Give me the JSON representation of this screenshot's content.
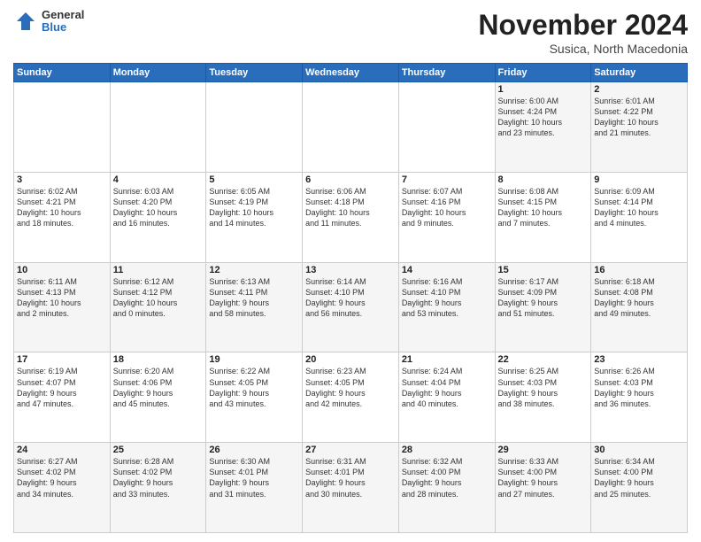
{
  "logo": {
    "general": "General",
    "blue": "Blue"
  },
  "header": {
    "month": "November 2024",
    "location": "Susica, North Macedonia"
  },
  "weekdays": [
    "Sunday",
    "Monday",
    "Tuesday",
    "Wednesday",
    "Thursday",
    "Friday",
    "Saturday"
  ],
  "weeks": [
    [
      {
        "day": "",
        "info": ""
      },
      {
        "day": "",
        "info": ""
      },
      {
        "day": "",
        "info": ""
      },
      {
        "day": "",
        "info": ""
      },
      {
        "day": "",
        "info": ""
      },
      {
        "day": "1",
        "info": "Sunrise: 6:00 AM\nSunset: 4:24 PM\nDaylight: 10 hours\nand 23 minutes."
      },
      {
        "day": "2",
        "info": "Sunrise: 6:01 AM\nSunset: 4:22 PM\nDaylight: 10 hours\nand 21 minutes."
      }
    ],
    [
      {
        "day": "3",
        "info": "Sunrise: 6:02 AM\nSunset: 4:21 PM\nDaylight: 10 hours\nand 18 minutes."
      },
      {
        "day": "4",
        "info": "Sunrise: 6:03 AM\nSunset: 4:20 PM\nDaylight: 10 hours\nand 16 minutes."
      },
      {
        "day": "5",
        "info": "Sunrise: 6:05 AM\nSunset: 4:19 PM\nDaylight: 10 hours\nand 14 minutes."
      },
      {
        "day": "6",
        "info": "Sunrise: 6:06 AM\nSunset: 4:18 PM\nDaylight: 10 hours\nand 11 minutes."
      },
      {
        "day": "7",
        "info": "Sunrise: 6:07 AM\nSunset: 4:16 PM\nDaylight: 10 hours\nand 9 minutes."
      },
      {
        "day": "8",
        "info": "Sunrise: 6:08 AM\nSunset: 4:15 PM\nDaylight: 10 hours\nand 7 minutes."
      },
      {
        "day": "9",
        "info": "Sunrise: 6:09 AM\nSunset: 4:14 PM\nDaylight: 10 hours\nand 4 minutes."
      }
    ],
    [
      {
        "day": "10",
        "info": "Sunrise: 6:11 AM\nSunset: 4:13 PM\nDaylight: 10 hours\nand 2 minutes."
      },
      {
        "day": "11",
        "info": "Sunrise: 6:12 AM\nSunset: 4:12 PM\nDaylight: 10 hours\nand 0 minutes."
      },
      {
        "day": "12",
        "info": "Sunrise: 6:13 AM\nSunset: 4:11 PM\nDaylight: 9 hours\nand 58 minutes."
      },
      {
        "day": "13",
        "info": "Sunrise: 6:14 AM\nSunset: 4:10 PM\nDaylight: 9 hours\nand 56 minutes."
      },
      {
        "day": "14",
        "info": "Sunrise: 6:16 AM\nSunset: 4:10 PM\nDaylight: 9 hours\nand 53 minutes."
      },
      {
        "day": "15",
        "info": "Sunrise: 6:17 AM\nSunset: 4:09 PM\nDaylight: 9 hours\nand 51 minutes."
      },
      {
        "day": "16",
        "info": "Sunrise: 6:18 AM\nSunset: 4:08 PM\nDaylight: 9 hours\nand 49 minutes."
      }
    ],
    [
      {
        "day": "17",
        "info": "Sunrise: 6:19 AM\nSunset: 4:07 PM\nDaylight: 9 hours\nand 47 minutes."
      },
      {
        "day": "18",
        "info": "Sunrise: 6:20 AM\nSunset: 4:06 PM\nDaylight: 9 hours\nand 45 minutes."
      },
      {
        "day": "19",
        "info": "Sunrise: 6:22 AM\nSunset: 4:05 PM\nDaylight: 9 hours\nand 43 minutes."
      },
      {
        "day": "20",
        "info": "Sunrise: 6:23 AM\nSunset: 4:05 PM\nDaylight: 9 hours\nand 42 minutes."
      },
      {
        "day": "21",
        "info": "Sunrise: 6:24 AM\nSunset: 4:04 PM\nDaylight: 9 hours\nand 40 minutes."
      },
      {
        "day": "22",
        "info": "Sunrise: 6:25 AM\nSunset: 4:03 PM\nDaylight: 9 hours\nand 38 minutes."
      },
      {
        "day": "23",
        "info": "Sunrise: 6:26 AM\nSunset: 4:03 PM\nDaylight: 9 hours\nand 36 minutes."
      }
    ],
    [
      {
        "day": "24",
        "info": "Sunrise: 6:27 AM\nSunset: 4:02 PM\nDaylight: 9 hours\nand 34 minutes."
      },
      {
        "day": "25",
        "info": "Sunrise: 6:28 AM\nSunset: 4:02 PM\nDaylight: 9 hours\nand 33 minutes."
      },
      {
        "day": "26",
        "info": "Sunrise: 6:30 AM\nSunset: 4:01 PM\nDaylight: 9 hours\nand 31 minutes."
      },
      {
        "day": "27",
        "info": "Sunrise: 6:31 AM\nSunset: 4:01 PM\nDaylight: 9 hours\nand 30 minutes."
      },
      {
        "day": "28",
        "info": "Sunrise: 6:32 AM\nSunset: 4:00 PM\nDaylight: 9 hours\nand 28 minutes."
      },
      {
        "day": "29",
        "info": "Sunrise: 6:33 AM\nSunset: 4:00 PM\nDaylight: 9 hours\nand 27 minutes."
      },
      {
        "day": "30",
        "info": "Sunrise: 6:34 AM\nSunset: 4:00 PM\nDaylight: 9 hours\nand 25 minutes."
      }
    ]
  ]
}
